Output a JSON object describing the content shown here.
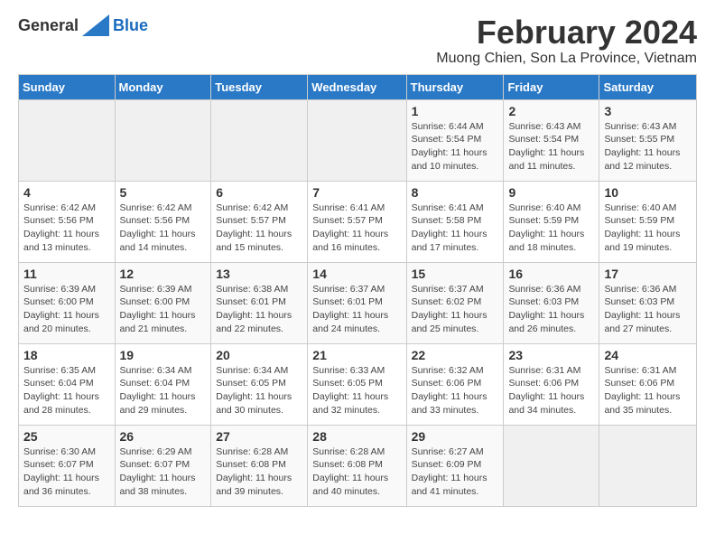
{
  "logo": {
    "general": "General",
    "blue": "Blue"
  },
  "title": "February 2024",
  "subtitle": "Muong Chien, Son La Province, Vietnam",
  "weekdays": [
    "Sunday",
    "Monday",
    "Tuesday",
    "Wednesday",
    "Thursday",
    "Friday",
    "Saturday"
  ],
  "weeks": [
    [
      {
        "day": "",
        "sunrise": "",
        "sunset": "",
        "daylight": ""
      },
      {
        "day": "",
        "sunrise": "",
        "sunset": "",
        "daylight": ""
      },
      {
        "day": "",
        "sunrise": "",
        "sunset": "",
        "daylight": ""
      },
      {
        "day": "",
        "sunrise": "",
        "sunset": "",
        "daylight": ""
      },
      {
        "day": "1",
        "sunrise": "Sunrise: 6:44 AM",
        "sunset": "Sunset: 5:54 PM",
        "daylight": "Daylight: 11 hours and 10 minutes."
      },
      {
        "day": "2",
        "sunrise": "Sunrise: 6:43 AM",
        "sunset": "Sunset: 5:54 PM",
        "daylight": "Daylight: 11 hours and 11 minutes."
      },
      {
        "day": "3",
        "sunrise": "Sunrise: 6:43 AM",
        "sunset": "Sunset: 5:55 PM",
        "daylight": "Daylight: 11 hours and 12 minutes."
      }
    ],
    [
      {
        "day": "4",
        "sunrise": "Sunrise: 6:42 AM",
        "sunset": "Sunset: 5:56 PM",
        "daylight": "Daylight: 11 hours and 13 minutes."
      },
      {
        "day": "5",
        "sunrise": "Sunrise: 6:42 AM",
        "sunset": "Sunset: 5:56 PM",
        "daylight": "Daylight: 11 hours and 14 minutes."
      },
      {
        "day": "6",
        "sunrise": "Sunrise: 6:42 AM",
        "sunset": "Sunset: 5:57 PM",
        "daylight": "Daylight: 11 hours and 15 minutes."
      },
      {
        "day": "7",
        "sunrise": "Sunrise: 6:41 AM",
        "sunset": "Sunset: 5:57 PM",
        "daylight": "Daylight: 11 hours and 16 minutes."
      },
      {
        "day": "8",
        "sunrise": "Sunrise: 6:41 AM",
        "sunset": "Sunset: 5:58 PM",
        "daylight": "Daylight: 11 hours and 17 minutes."
      },
      {
        "day": "9",
        "sunrise": "Sunrise: 6:40 AM",
        "sunset": "Sunset: 5:59 PM",
        "daylight": "Daylight: 11 hours and 18 minutes."
      },
      {
        "day": "10",
        "sunrise": "Sunrise: 6:40 AM",
        "sunset": "Sunset: 5:59 PM",
        "daylight": "Daylight: 11 hours and 19 minutes."
      }
    ],
    [
      {
        "day": "11",
        "sunrise": "Sunrise: 6:39 AM",
        "sunset": "Sunset: 6:00 PM",
        "daylight": "Daylight: 11 hours and 20 minutes."
      },
      {
        "day": "12",
        "sunrise": "Sunrise: 6:39 AM",
        "sunset": "Sunset: 6:00 PM",
        "daylight": "Daylight: 11 hours and 21 minutes."
      },
      {
        "day": "13",
        "sunrise": "Sunrise: 6:38 AM",
        "sunset": "Sunset: 6:01 PM",
        "daylight": "Daylight: 11 hours and 22 minutes."
      },
      {
        "day": "14",
        "sunrise": "Sunrise: 6:37 AM",
        "sunset": "Sunset: 6:01 PM",
        "daylight": "Daylight: 11 hours and 24 minutes."
      },
      {
        "day": "15",
        "sunrise": "Sunrise: 6:37 AM",
        "sunset": "Sunset: 6:02 PM",
        "daylight": "Daylight: 11 hours and 25 minutes."
      },
      {
        "day": "16",
        "sunrise": "Sunrise: 6:36 AM",
        "sunset": "Sunset: 6:03 PM",
        "daylight": "Daylight: 11 hours and 26 minutes."
      },
      {
        "day": "17",
        "sunrise": "Sunrise: 6:36 AM",
        "sunset": "Sunset: 6:03 PM",
        "daylight": "Daylight: 11 hours and 27 minutes."
      }
    ],
    [
      {
        "day": "18",
        "sunrise": "Sunrise: 6:35 AM",
        "sunset": "Sunset: 6:04 PM",
        "daylight": "Daylight: 11 hours and 28 minutes."
      },
      {
        "day": "19",
        "sunrise": "Sunrise: 6:34 AM",
        "sunset": "Sunset: 6:04 PM",
        "daylight": "Daylight: 11 hours and 29 minutes."
      },
      {
        "day": "20",
        "sunrise": "Sunrise: 6:34 AM",
        "sunset": "Sunset: 6:05 PM",
        "daylight": "Daylight: 11 hours and 30 minutes."
      },
      {
        "day": "21",
        "sunrise": "Sunrise: 6:33 AM",
        "sunset": "Sunset: 6:05 PM",
        "daylight": "Daylight: 11 hours and 32 minutes."
      },
      {
        "day": "22",
        "sunrise": "Sunrise: 6:32 AM",
        "sunset": "Sunset: 6:06 PM",
        "daylight": "Daylight: 11 hours and 33 minutes."
      },
      {
        "day": "23",
        "sunrise": "Sunrise: 6:31 AM",
        "sunset": "Sunset: 6:06 PM",
        "daylight": "Daylight: 11 hours and 34 minutes."
      },
      {
        "day": "24",
        "sunrise": "Sunrise: 6:31 AM",
        "sunset": "Sunset: 6:06 PM",
        "daylight": "Daylight: 11 hours and 35 minutes."
      }
    ],
    [
      {
        "day": "25",
        "sunrise": "Sunrise: 6:30 AM",
        "sunset": "Sunset: 6:07 PM",
        "daylight": "Daylight: 11 hours and 36 minutes."
      },
      {
        "day": "26",
        "sunrise": "Sunrise: 6:29 AM",
        "sunset": "Sunset: 6:07 PM",
        "daylight": "Daylight: 11 hours and 38 minutes."
      },
      {
        "day": "27",
        "sunrise": "Sunrise: 6:28 AM",
        "sunset": "Sunset: 6:08 PM",
        "daylight": "Daylight: 11 hours and 39 minutes."
      },
      {
        "day": "28",
        "sunrise": "Sunrise: 6:28 AM",
        "sunset": "Sunset: 6:08 PM",
        "daylight": "Daylight: 11 hours and 40 minutes."
      },
      {
        "day": "29",
        "sunrise": "Sunrise: 6:27 AM",
        "sunset": "Sunset: 6:09 PM",
        "daylight": "Daylight: 11 hours and 41 minutes."
      },
      {
        "day": "",
        "sunrise": "",
        "sunset": "",
        "daylight": ""
      },
      {
        "day": "",
        "sunrise": "",
        "sunset": "",
        "daylight": ""
      }
    ]
  ]
}
